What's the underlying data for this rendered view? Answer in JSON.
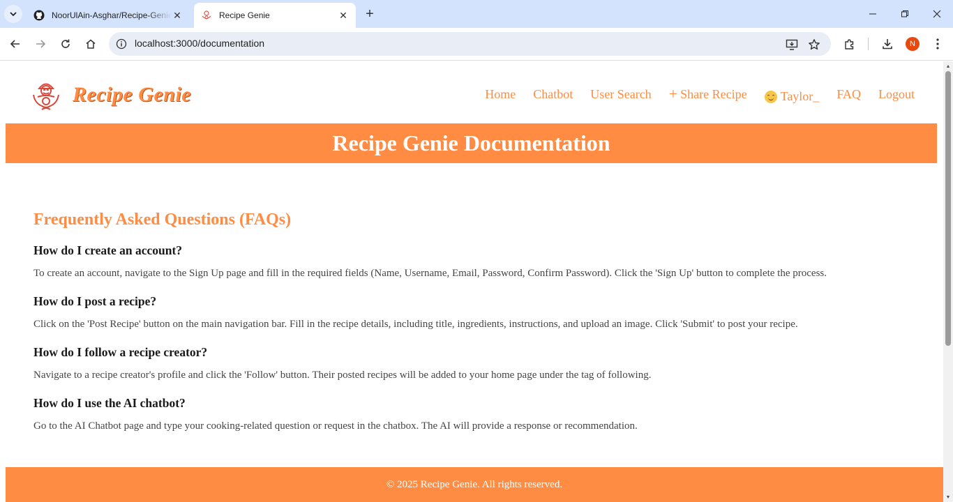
{
  "browser": {
    "tabs": [
      {
        "title": "NoorUlAin-Asghar/Recipe-Genie",
        "favicon": "github-icon",
        "active": false
      },
      {
        "title": "Recipe Genie",
        "favicon": "genie-icon",
        "active": true
      }
    ],
    "url": "localhost:3000/documentation",
    "profile_initial": "N"
  },
  "navbar": {
    "brand": "Recipe Genie",
    "links": {
      "home": "Home",
      "chatbot": "Chatbot",
      "user_search": "User Search",
      "share_recipe": "Share Recipe",
      "user": "Taylor_",
      "faq": "FAQ",
      "logout": "Logout"
    }
  },
  "hero": {
    "title": "Recipe Genie Documentation"
  },
  "faq": {
    "heading": "Frequently Asked Questions (FAQs)",
    "items": [
      {
        "q": "How do I create an account?",
        "a": "To create an account, navigate to the Sign Up page and fill in the required fields (Name, Username, Email, Password, Confirm Password). Click the 'Sign Up' button to complete the process."
      },
      {
        "q": "How do I post a recipe?",
        "a": "Click on the 'Post Recipe' button on the main navigation bar. Fill in the recipe details, including title, ingredients, instructions, and upload an image. Click 'Submit' to post your recipe."
      },
      {
        "q": "How do I follow a recipe creator?",
        "a": "Navigate to a recipe creator's profile and click the 'Follow' button. Their posted recipes will be added to your home page under the tag of following."
      },
      {
        "q": "How do I use the AI chatbot?",
        "a": "Go to the AI Chatbot page and type your cooking-related question or request in the chatbox. The AI will provide a response or recommendation."
      }
    ]
  },
  "footer": {
    "text": "© 2025 Recipe Genie. All rights reserved."
  },
  "colors": {
    "accent": "#ff8c42",
    "tabbar": "#d3e3fd"
  }
}
